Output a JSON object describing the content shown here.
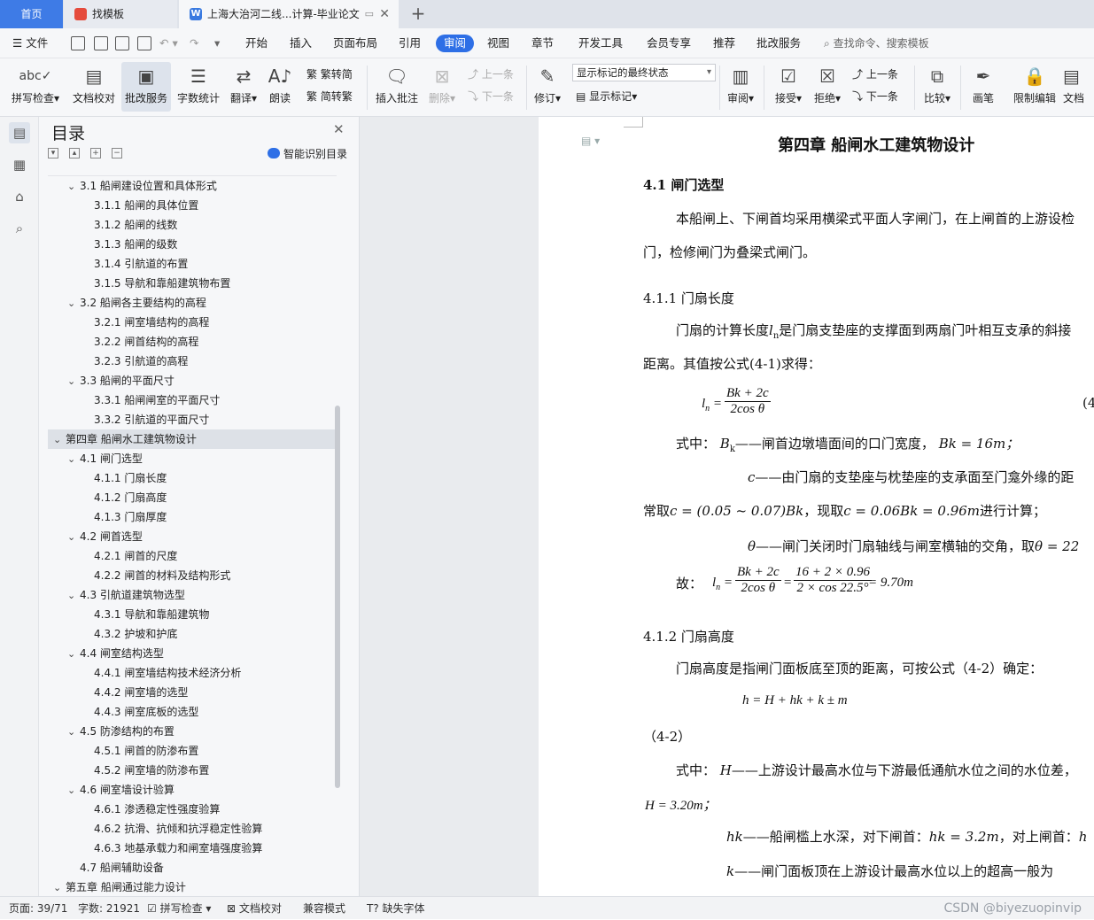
{
  "tabs": {
    "home": "首页",
    "find_template": "找模板",
    "document": "上海大治河二线...计算-毕业论文"
  },
  "menu": {
    "file": "文件",
    "items": [
      "开始",
      "插入",
      "页面布局",
      "引用",
      "审阅",
      "视图",
      "章节",
      "开发工具",
      "会员专享",
      "推荐",
      "批改服务"
    ],
    "active": "审阅",
    "search_placeholder": "查找命令、搜索模板"
  },
  "ribbon": {
    "spellcheck": "拼写检查",
    "doc_proof": "文档校对",
    "review_service": "批改服务",
    "word_count": "字数统计",
    "translate": "翻译",
    "read_aloud": "朗读",
    "trad_to_simp": "繁转简",
    "simp_to_trad": "简转繁",
    "insert_comment": "插入批注",
    "delete": "删除",
    "prev_comment": "上一条",
    "next_comment": "下一条",
    "track_changes": "修订",
    "markup_state": "显示标记的最终状态",
    "show_markup": "显示标记",
    "review": "审阅",
    "accept": "接受",
    "reject": "拒绝",
    "prev_change": "上一条",
    "next_change": "下一条",
    "compare": "比较",
    "pen": "画笔",
    "restrict_edit": "限制编辑",
    "doc_partial": "文档"
  },
  "toc": {
    "title": "目录",
    "ai_detect": "智能识别目录",
    "items": [
      {
        "level": 2,
        "text": "3.1 船闸建设位置和具体形式",
        "expanded": true
      },
      {
        "level": 3,
        "text": "3.1.1 船闸的具体位置"
      },
      {
        "level": 3,
        "text": "3.1.2 船闸的线数"
      },
      {
        "level": 3,
        "text": "3.1.3 船闸的级数"
      },
      {
        "level": 3,
        "text": "3.1.4 引航道的布置"
      },
      {
        "level": 3,
        "text": "3.1.5 导航和靠船建筑物布置"
      },
      {
        "level": 2,
        "text": "3.2 船闸各主要结构的高程",
        "expanded": true
      },
      {
        "level": 3,
        "text": "3.2.1 闸室墙结构的高程"
      },
      {
        "level": 3,
        "text": "3.2.2 闸首结构的高程"
      },
      {
        "level": 3,
        "text": "3.2.3 引航道的高程"
      },
      {
        "level": 2,
        "text": "3.3 船闸的平面尺寸",
        "expanded": true
      },
      {
        "level": 3,
        "text": "3.3.1 船闸闸室的平面尺寸"
      },
      {
        "level": 3,
        "text": "3.3.2 引航道的平面尺寸"
      },
      {
        "level": 1,
        "text": "第四章  船闸水工建筑物设计",
        "expanded": true,
        "selected": true
      },
      {
        "level": 2,
        "text": "4.1 闸门选型",
        "expanded": true
      },
      {
        "level": 3,
        "text": "4.1.1 门扇长度"
      },
      {
        "level": 3,
        "text": "4.1.2 门扇高度"
      },
      {
        "level": 3,
        "text": "4.1.3 门扇厚度"
      },
      {
        "level": 2,
        "text": "4.2 闸首选型",
        "expanded": true
      },
      {
        "level": 3,
        "text": "4.2.1 闸首的尺度"
      },
      {
        "level": 3,
        "text": "4.2.2 闸首的材料及结构形式"
      },
      {
        "level": 2,
        "text": "4.3 引航道建筑物选型",
        "expanded": true
      },
      {
        "level": 3,
        "text": "4.3.1 导航和靠船建筑物"
      },
      {
        "level": 3,
        "text": "4.3.2 护坡和护底"
      },
      {
        "level": 2,
        "text": "4.4 闸室结构选型",
        "expanded": true
      },
      {
        "level": 3,
        "text": "4.4.1 闸室墙结构技术经济分析"
      },
      {
        "level": 3,
        "text": "4.4.2 闸室墙的选型"
      },
      {
        "level": 3,
        "text": "4.4.3 闸室底板的选型"
      },
      {
        "level": 2,
        "text": "4.5 防渗结构的布置",
        "expanded": true
      },
      {
        "level": 3,
        "text": "4.5.1 闸首的防渗布置"
      },
      {
        "level": 3,
        "text": "4.5.2 闸室墙的防渗布置"
      },
      {
        "level": 2,
        "text": "4.6 闸室墙设计验算",
        "expanded": true
      },
      {
        "level": 3,
        "text": "4.6.1 渗透稳定性强度验算"
      },
      {
        "level": 3,
        "text": "4.6.2 抗滑、抗倾和抗浮稳定性验算"
      },
      {
        "level": 3,
        "text": "4.6.3 地基承载力和闸室墙强度验算"
      },
      {
        "level": 2,
        "text": "4.7 船闸辅助设备",
        "expanded": false,
        "leaf": true
      },
      {
        "level": 1,
        "text": "第五章  船闸通过能力设计",
        "expanded": true
      }
    ]
  },
  "document": {
    "chapter_title": "第四章  船闸水工建筑物设计",
    "s41": "4.1 闸门选型",
    "p1a": "本船闸上、下闸首均采用横梁式平面人字闸门，在上闸首的上游设检",
    "p1b": "门，检修闸门为叠梁式闸门。",
    "s411": "4.1.1 门扇长度",
    "p2a_pre": "门扇的计算长度",
    "p2a_var": "l",
    "p2a_sub": "n",
    "p2a_post": "是门扇支垫座的支撑面到两扇门叶相互支承的斜接",
    "p2b": "距离。其值按公式(4-1)求得：",
    "eq1_lhs": "l",
    "eq1_lhs_sub": "n",
    "eq1_num": "Bk + 2c",
    "eq1_den": "2cos θ",
    "eq1_label": "(4",
    "where1": "式中：",
    "def_bk_var": "B",
    "def_bk_sub": "k",
    "def_bk_text": "——闸首边墩墙面间的口门宽度，",
    "def_bk_val": "Bk = 16m；",
    "def_c_var": "c",
    "def_c_text": "——由门扇的支垫座与枕垫座的支承面至门龛外缘的距",
    "def_c2_pre": "常取",
    "def_c2_eq": "c = (0.05 ~ 0.07)Bk",
    "def_c2_mid": "，现取",
    "def_c2_eq2": "c = 0.06Bk = 0.96m",
    "def_c2_post": "进行计算；",
    "def_theta_var": "θ",
    "def_theta_text": "——闸门关闭时门扇轴线与闸室横轴的交角，取",
    "def_theta_val": "θ = 22",
    "so": "故：",
    "eq2_num1": "Bk + 2c",
    "eq2_den1": "2cos θ",
    "eq2_num2": "16 + 2 × 0.96",
    "eq2_den2": "2 × cos 22.5°",
    "eq2_result": "= 9.70m",
    "s412": "4.1.2 门扇高度",
    "p3": "门扇高度是指闸门面板底至顶的距离，可按公式（4-2）确定：",
    "eq3": "h = H + hk + k ± m",
    "eq3_label": "（4-2）",
    "where2": "式中：",
    "def_h_var": "H",
    "def_h_text": "——上游设计最高水位与下游最低通航水位之间的水位差，",
    "def_h_val": "H = 3.20m；",
    "def_hk_var": "hk",
    "def_hk_text": "——船闸槛上水深，对下闸首：",
    "def_hk_val": "hk = 3.2m",
    "def_hk_post": "，对上闸首：",
    "def_hk_tail": "h",
    "def_k_var": "k",
    "def_k_text": "——闸门面板顶在上游设计最高水位以上的超高一般为"
  },
  "status": {
    "page": "页面: 39/71",
    "words": "字数: 21921",
    "spellcheck": "拼写检查",
    "proof": "文档校对",
    "compat": "兼容模式",
    "missing_font": "缺失字体"
  },
  "watermark": "CSDN @biyezuopinvip"
}
